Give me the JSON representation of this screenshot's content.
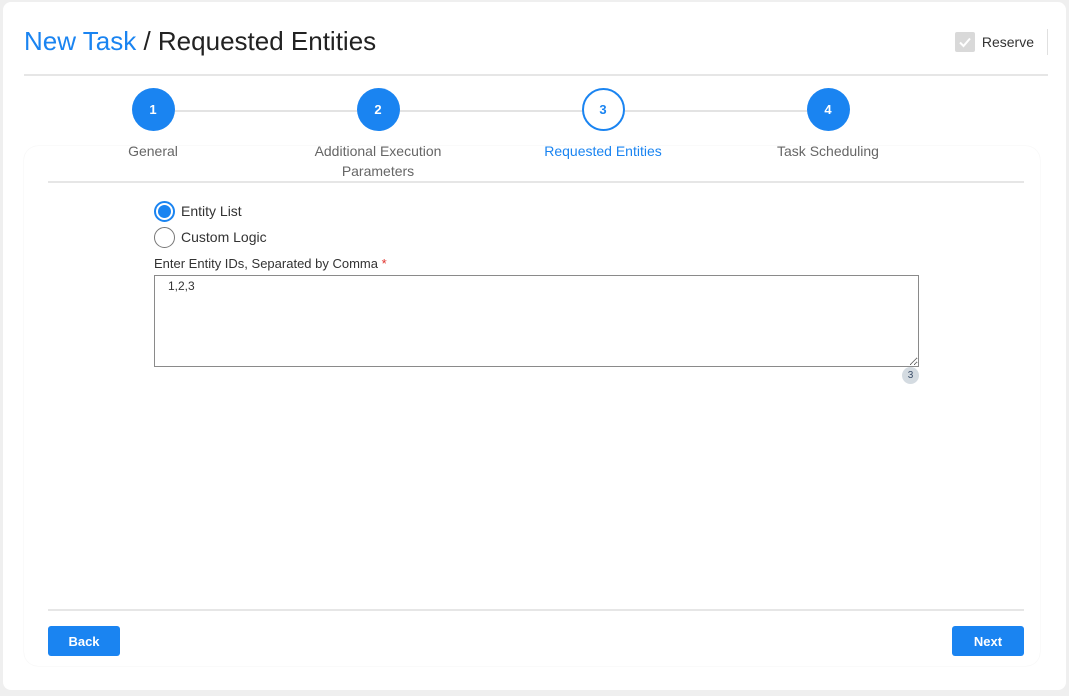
{
  "header": {
    "breadcrumb_link": "New Task",
    "separator": " / ",
    "current_page": "Requested Entities",
    "reserve": {
      "label": "Reserve",
      "checked": true,
      "disabled": true
    }
  },
  "stepper": {
    "steps": [
      {
        "number": "1",
        "label": "General",
        "state": "completed"
      },
      {
        "number": "2",
        "label": "Additional Execution Parameters",
        "state": "completed"
      },
      {
        "number": "3",
        "label": "Requested Entities",
        "state": "active"
      },
      {
        "number": "4",
        "label": "Task Scheduling",
        "state": "completed"
      }
    ]
  },
  "form": {
    "mode_options": [
      {
        "label": "Entity List",
        "selected": true
      },
      {
        "label": "Custom Logic",
        "selected": false
      }
    ],
    "entity_ids_label": "Enter Entity IDs, Separated by Comma",
    "required_marker": "*",
    "entity_ids_value": "1,2,3",
    "entity_count": "3"
  },
  "footer": {
    "back_label": "Back",
    "next_label": "Next"
  },
  "colors": {
    "accent": "#1a84f1",
    "required": "#e0302a"
  }
}
